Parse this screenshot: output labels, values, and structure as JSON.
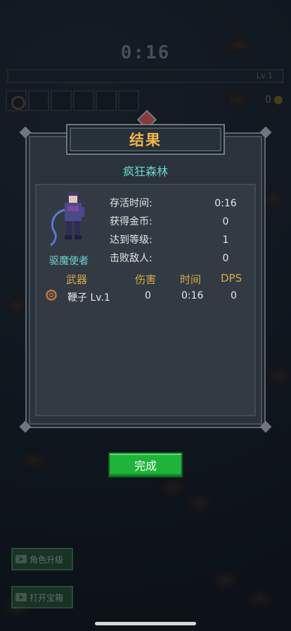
{
  "hud": {
    "timer": "0:16",
    "level_label": "Lv 1",
    "gold": "0"
  },
  "result": {
    "title": "结果",
    "stage_name": "疯狂森林",
    "character_name": "驱魔使者",
    "stats": [
      {
        "label": "存活时间:",
        "value": "0:16"
      },
      {
        "label": "获得金币:",
        "value": "0"
      },
      {
        "label": "达到等级:",
        "value": "1"
      },
      {
        "label": "击败敌人:",
        "value": "0"
      }
    ],
    "weapon_headers": {
      "weapon": "武器",
      "damage": "伤害",
      "time": "时间",
      "dps": "DPS"
    },
    "weapons": [
      {
        "name": "鞭子 Lv.1",
        "damage": "0",
        "time": "0:16",
        "dps": "0",
        "icon": "whip-icon"
      }
    ],
    "done_label": "完成"
  },
  "side_buttons": {
    "upgrade": "角色升级",
    "chest": "打开宝箱"
  },
  "colors": {
    "title": "#f2b44a",
    "accent": "#6fd3cf",
    "header": "#d8a84a",
    "done": "#1fb33b"
  }
}
